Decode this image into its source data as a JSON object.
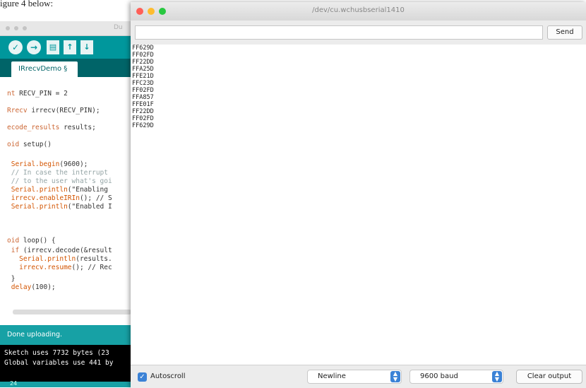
{
  "caption": "igure 4 below:",
  "ide": {
    "title": "Du",
    "tab_label": "IRrecvDemo §",
    "code_lines": [
      {
        "a": "nt",
        "b": " RECV_PIN = 2"
      },
      {
        "a": "Rrecv",
        "b": " irrecv(RECV_PIN);"
      },
      {
        "a": "ecode_results",
        "b": " results;"
      },
      {
        "a": "oid",
        "b": " setup()"
      },
      {
        "a": " Serial.begin",
        "b": "(9600);"
      },
      {
        "c": " // In case the interrupt"
      },
      {
        "c": " // to the user what's goi"
      },
      {
        "a": " Serial.println",
        "b": "(\"Enabling"
      },
      {
        "a": " irrecv.enableIRIn",
        "b": "(); // S"
      },
      {
        "a": " Serial.println",
        "b": "(\"Enabled I"
      },
      {
        "a": "oid",
        "b": " loop() {"
      },
      {
        "a": " if",
        "b": " (irrecv.decode(&result"
      },
      {
        "a": "   Serial.println",
        "b": "(results."
      },
      {
        "a": "   irrecv.resume",
        "b": "(); // Rec"
      },
      {
        "b": " }"
      },
      {
        "a": " delay",
        "b": "(100);"
      }
    ],
    "status": "Done uploading.",
    "console": [
      "Sketch uses 7732 bytes (23",
      "Global variables use 441 by"
    ],
    "footer_line": "24"
  },
  "monitor": {
    "title": "/dev/cu.wchusbserial1410",
    "input_value": "",
    "send_label": "Send",
    "output_lines": [
      "FF629D",
      "FF02FD",
      "FF22DD",
      "FFA25D",
      "FFE21D",
      "FFC23D",
      "FF02FD",
      "FFA857",
      "FFE01F",
      "FF22DD",
      "FF02FD",
      "FF629D"
    ],
    "autoscroll_label": "Autoscroll",
    "line_ending": "Newline",
    "baud": "9600 baud",
    "clear_label": "Clear output"
  },
  "colors": {
    "arduino_teal": "#00979c",
    "arduino_dark_teal": "#006468",
    "mac_close": "#ff5f57",
    "mac_minimize": "#febc2e",
    "mac_zoom": "#28c840",
    "select_accent": "#3b82d6"
  }
}
